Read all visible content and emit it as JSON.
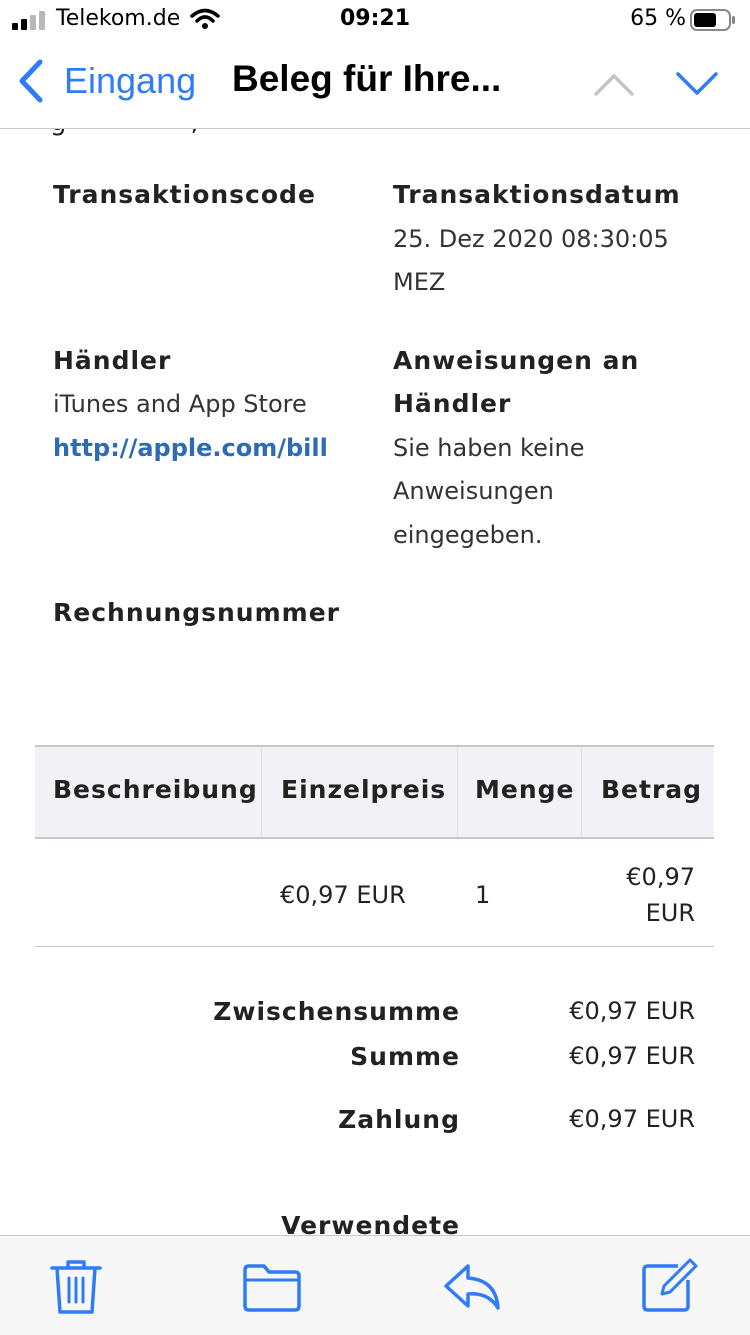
{
  "status_bar": {
    "carrier": "Telekom.de",
    "time": "09:21",
    "battery_percent": "65 %"
  },
  "nav": {
    "back_label": "Eingang",
    "title": "Beleg für Ihre..."
  },
  "details": {
    "transaction_code_label": "Transaktionscode",
    "transaction_date_label": "Transaktionsdatum",
    "transaction_date_value_line1": "25. Dez 2020 08:30:05",
    "transaction_date_value_line2": "MEZ",
    "merchant_label": "Händler",
    "merchant_value": "iTunes and App Store",
    "merchant_link": "http://apple.com/bill",
    "instructions_label_line1": "Anweisungen an",
    "instructions_label_line2": "Händler",
    "instructions_value_line1": "Sie haben keine",
    "instructions_value_line2": "Anweisungen",
    "instructions_value_line3": "eingegeben.",
    "invoice_number_label": "Rechnungsnummer"
  },
  "table": {
    "headers": [
      "Beschreibung",
      "Einzelpreis",
      "Menge",
      "Betrag"
    ],
    "rows": [
      {
        "description": "",
        "unit_price": "€0,97 EUR",
        "quantity": "1",
        "amount_line1": "€0,97",
        "amount_line2": "EUR"
      }
    ]
  },
  "totals": {
    "subtotal_label": "Zwischensumme",
    "subtotal_value": "€0,97 EUR",
    "total_label": "Summe",
    "total_value": "€0,97 EUR",
    "payment_label": "Zahlung",
    "payment_value": "€0,97 EUR",
    "used_label": "Verwendete"
  },
  "toolbar": {
    "icons": [
      "trash-icon",
      "folder-icon",
      "reply-icon",
      "compose-icon"
    ]
  },
  "colors": {
    "accent": "#2f7cf6",
    "link": "#2d6bb3",
    "header_bg": "#f2f2f6"
  }
}
